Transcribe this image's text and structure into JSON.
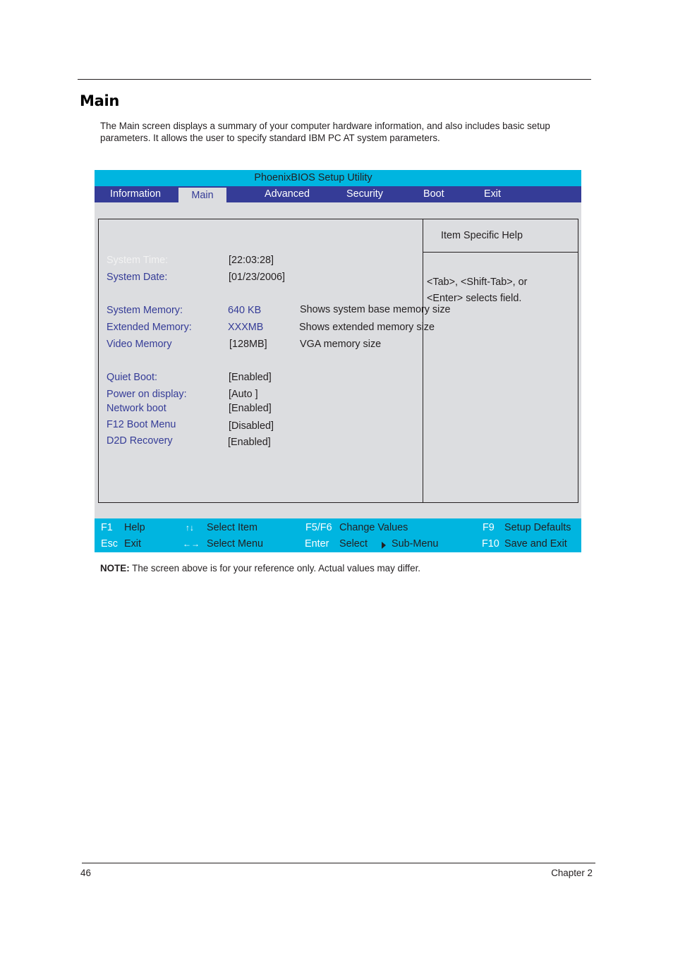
{
  "page": {
    "title": "Main",
    "intro": "The Main screen displays a summary of your computer hardware information, and also includes basic setup parameters. It allows the user to specify standard IBM PC AT system parameters.",
    "note_label": "NOTE:",
    "note_text": " The screen above is for your reference only. Actual values may differ.",
    "page_number": "46",
    "chapter": "Chapter 2"
  },
  "bios": {
    "title": "PhoenixBIOS Setup Utility",
    "colors": {
      "title_bar": "#00b5e0",
      "menu_bar": "#353c97",
      "panel_bg": "#dcdde0",
      "label_text": "#353c97"
    },
    "menu": [
      {
        "label": "Information",
        "active": false
      },
      {
        "label": "Main",
        "active": true
      },
      {
        "label": "Advanced",
        "active": false
      },
      {
        "label": "Security",
        "active": false
      },
      {
        "label": "Boot",
        "active": false
      },
      {
        "label": "Exit",
        "active": false
      }
    ],
    "fields": [
      {
        "label": "System Time:",
        "value": "[22:03:28]",
        "desc": "",
        "selected": true
      },
      {
        "label": "System Date:",
        "value": "[01/23/2006]",
        "desc": ""
      },
      {
        "label": "System Memory:",
        "value": "640 KB",
        "desc": "Shows system base memory size"
      },
      {
        "label": "Extended Memory:",
        "value": "XXXMB",
        "desc": "Shows extended memory size"
      },
      {
        "label": "Video Memory",
        "value": "[128MB]",
        "desc": "VGA memory size"
      },
      {
        "label": "Quiet Boot:",
        "value": "[Enabled]",
        "desc": ""
      },
      {
        "label": "Power on display:",
        "value": "[Auto ]",
        "desc": ""
      },
      {
        "label": "Network boot",
        "value": "[Enabled]",
        "desc": ""
      },
      {
        "label": "F12 Boot Menu",
        "value": "[Disabled]",
        "desc": ""
      },
      {
        "label": "D2D Recovery",
        "value": "[Enabled]",
        "desc": ""
      }
    ],
    "help": {
      "title": "Item Specific Help",
      "lines": [
        "<Tab>, <Shift-Tab>, or",
        "<Enter> selects field."
      ]
    },
    "keys": [
      {
        "key": "F1",
        "desc": "Help",
        "icon": "f1-key"
      },
      {
        "key": "Esc",
        "desc": "Exit",
        "icon": "esc-key"
      },
      {
        "key": "↑↓",
        "desc": "Select Item",
        "icon": "up-down-arrows-icon"
      },
      {
        "key": "←→",
        "desc": "Select Menu",
        "icon": "left-right-arrows-icon"
      },
      {
        "key": "F5/F6",
        "desc": "Change Values",
        "icon": "f5-f6-key"
      },
      {
        "key": "Enter",
        "desc": "Select",
        "icon": "enter-key"
      },
      {
        "key": "",
        "desc": "Sub-Menu",
        "icon": "triangle-right-icon"
      },
      {
        "key": "F9",
        "desc": "Setup Defaults",
        "icon": "f9-key"
      },
      {
        "key": "F10",
        "desc": "Save and Exit",
        "icon": "f10-key"
      }
    ]
  }
}
